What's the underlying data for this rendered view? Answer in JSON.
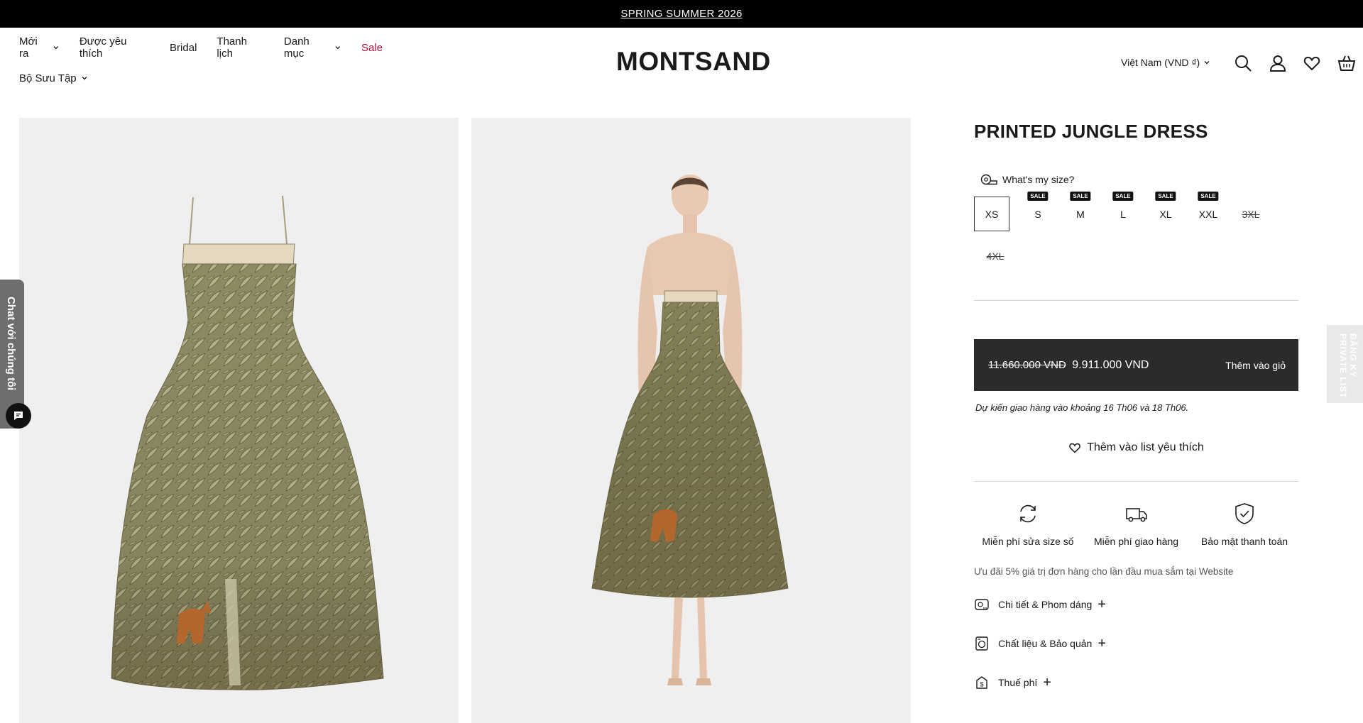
{
  "announcement": {
    "text": "SPRING SUMMER 2026"
  },
  "nav": {
    "row1": [
      {
        "label": "Mới ra",
        "dropdown": true
      },
      {
        "label": "Được yêu thích",
        "dropdown": false
      },
      {
        "label": "Bridal",
        "dropdown": false
      },
      {
        "label": "Thanh lịch",
        "dropdown": false
      },
      {
        "label": "Danh mục",
        "dropdown": true
      },
      {
        "label": "Sale",
        "dropdown": false,
        "color": "#b3123f"
      }
    ],
    "row2": [
      {
        "label": "Bộ Sưu Tập",
        "dropdown": true
      }
    ]
  },
  "brand": {
    "logo": "MONTSAND"
  },
  "header": {
    "country": "Việt Nam (VND ₫)",
    "icons": [
      "search-icon",
      "account-icon",
      "heart-icon",
      "cart-icon"
    ]
  },
  "chat": {
    "label": "Chat với chúng tôi"
  },
  "private_list": {
    "label": "ĐĂNG KÝ PRIVATE LIST"
  },
  "product": {
    "title": "PRINTED JUNGLE DRESS",
    "size_guide": "What's my size?",
    "sizes": [
      {
        "label": "XS",
        "selected": true,
        "sale": false,
        "available": true
      },
      {
        "label": "S",
        "selected": false,
        "sale": true,
        "available": true
      },
      {
        "label": "M",
        "selected": false,
        "sale": true,
        "available": true
      },
      {
        "label": "L",
        "selected": false,
        "sale": true,
        "available": true
      },
      {
        "label": "XL",
        "selected": false,
        "sale": true,
        "available": true
      },
      {
        "label": "XXL",
        "selected": false,
        "sale": true,
        "available": true
      },
      {
        "label": "3XL",
        "selected": false,
        "sale": false,
        "available": false
      },
      {
        "label": "4XL",
        "selected": false,
        "sale": false,
        "available": false
      }
    ],
    "sale_badge": "SALE",
    "price_old": "11.660.000 VND",
    "price_new": "9.911.000 VND",
    "add_to_cart": "Thêm vào giỏ",
    "delivery": "Dự kiến giao hàng vào khoảng 16 Th06 và 18 Th06.",
    "wishlist": "Thêm vào list yêu thích",
    "features": [
      {
        "icon": "refresh-icon",
        "label": "Miễn phí sửa size số"
      },
      {
        "icon": "truck-icon",
        "label": "Miễn phí giao hàng"
      },
      {
        "icon": "shield-check-icon",
        "label": "Bảo mật thanh toán"
      }
    ],
    "promo": "Ưu đãi 5% giá trị đơn hàng cho lần đầu mua sắm tại Website",
    "accordion": [
      {
        "icon": "measuring-tape-icon",
        "label": "Chi tiết & Phom dáng"
      },
      {
        "icon": "washing-machine-icon",
        "label": "Chất liệu & Bảo quản"
      },
      {
        "icon": "tax-tag-icon",
        "label": "Thuế phí"
      }
    ]
  },
  "colors": {
    "accent_sale": "#b3123f",
    "button_bg": "#2b2b2b",
    "photo_bg": "#efefef"
  }
}
